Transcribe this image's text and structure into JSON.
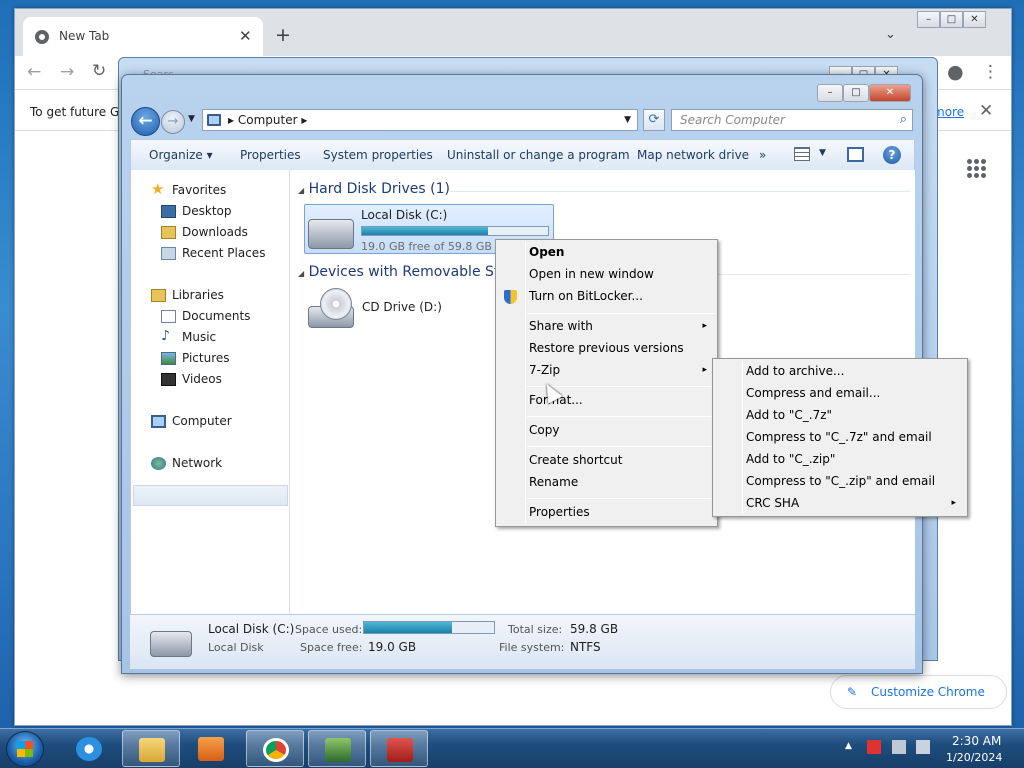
{
  "browser": {
    "tab_title": "New Tab",
    "tab_close": "✕",
    "new_tab": "+",
    "tab_dropdown": "⌄",
    "back": "←",
    "forward": "→",
    "reload": "↻",
    "avatar_glyph": "●",
    "menu_glyph": "⋮",
    "infobar_text": "To get future Go",
    "infobar_link": "more",
    "infobar_close": "✕",
    "customize_label": "Customize Chrome",
    "customize_glyph": "✎"
  },
  "explorer_back": {
    "search_hint": "Searc"
  },
  "explorer": {
    "address": "Computer",
    "address_sep": "▸",
    "search_placeholder": "Search Computer",
    "toolbar": [
      "Organize ▾",
      "Properties",
      "System properties",
      "Uninstall or change a program",
      "Map network drive",
      "»"
    ],
    "nav": {
      "favorites": "Favorites",
      "desktop": "Desktop",
      "downloads": "Downloads",
      "recent": "Recent Places",
      "libraries": "Libraries",
      "documents": "Documents",
      "music": "Music",
      "pictures": "Pictures",
      "videos": "Videos",
      "computer": "Computer",
      "network": "Network"
    },
    "groups": {
      "hdd": "Hard Disk Drives (1)",
      "removable": "Devices with Removable Sto"
    },
    "drives": {
      "c_name": "Local Disk (C:)",
      "c_free": "19.0 GB free of 59.8 GB",
      "c_used_fraction": 0.68,
      "d_name": "CD Drive (D:)"
    },
    "details": {
      "name": "Local Disk (C:)",
      "type": "Local Disk",
      "space_used_label": "Space used:",
      "space_used_fraction": 0.68,
      "space_free_label": "Space free:",
      "space_free_value": "19.0 GB",
      "total_label": "Total size:",
      "total_value": "59.8 GB",
      "fs_label": "File system:",
      "fs_value": "NTFS"
    }
  },
  "context_menu": {
    "open": "Open",
    "open_new": "Open in new window",
    "bitlocker": "Turn on BitLocker...",
    "share": "Share with",
    "restore": "Restore previous versions",
    "zip": "7-Zip",
    "format": "Format...",
    "copy": "Copy",
    "shortcut": "Create shortcut",
    "rename": "Rename",
    "properties": "Properties",
    "arrow": "▸"
  },
  "zip_menu": {
    "add_archive": "Add to archive...",
    "compress_email": "Compress and email...",
    "add_7z": "Add to \"C_.7z\"",
    "compress_7z_email": "Compress to \"C_.7z\" and email",
    "add_zip": "Add to \"C_.zip\"",
    "compress_zip_email": "Compress to \"C_.zip\" and email",
    "crc": "CRC SHA",
    "arrow": "▸"
  },
  "taskbar": {
    "time": "2:30 AM",
    "date": "1/20/2024",
    "tray_up": "▲"
  },
  "colors": {
    "accent": "#1a73e8",
    "drive_bar": "#1b81a8",
    "menu_bg": "#f0f0f0"
  }
}
